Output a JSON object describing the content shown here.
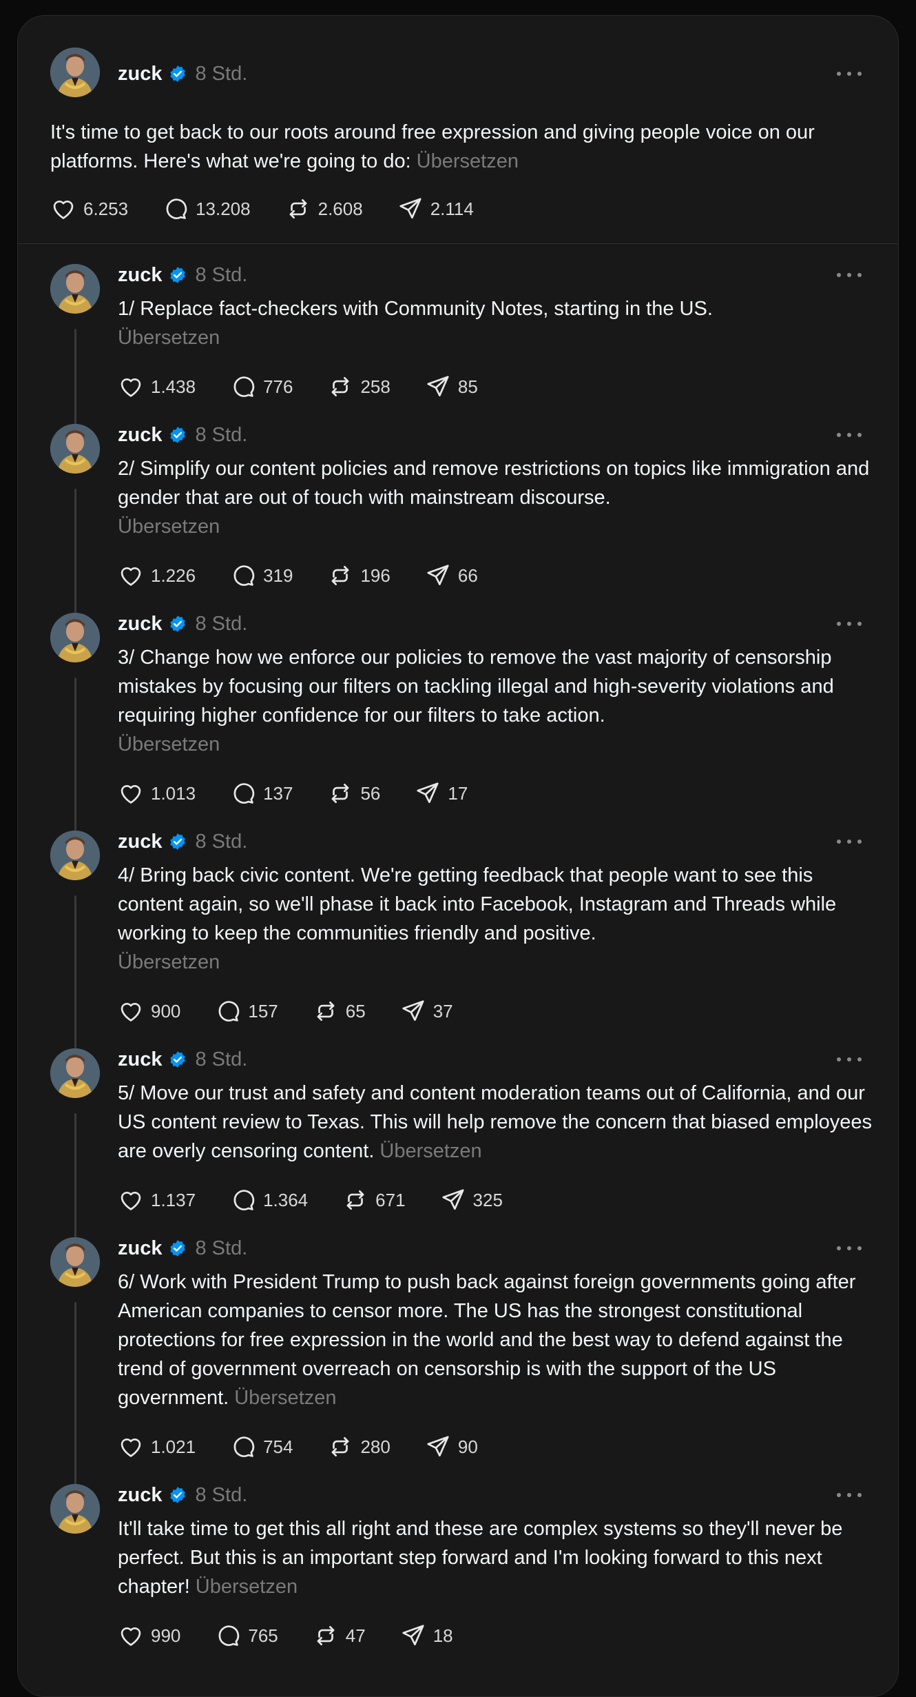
{
  "posts": [
    {
      "username": "zuck",
      "time": "8 Std.",
      "text": "It's time to get back to our roots around free expression and giving people voice on our platforms. Here's what we're going to do:",
      "translate": "Übersetzen",
      "likes": "6.253",
      "replies": "13.208",
      "reposts": "2.608",
      "shares": "2.114"
    },
    {
      "username": "zuck",
      "time": "8 Std.",
      "text": "1/ Replace fact-checkers with Community Notes, starting in the US.",
      "translate": "Übersetzen",
      "likes": "1.438",
      "replies": "776",
      "reposts": "258",
      "shares": "85"
    },
    {
      "username": "zuck",
      "time": "8 Std.",
      "text": "2/ Simplify our content policies and remove restrictions on topics like immigration and gender that are out of touch with mainstream discourse.",
      "translate": "Übersetzen",
      "likes": "1.226",
      "replies": "319",
      "reposts": "196",
      "shares": "66"
    },
    {
      "username": "zuck",
      "time": "8 Std.",
      "text": "3/ Change how we enforce our policies to remove the vast majority of censorship mistakes by focusing our filters on tackling illegal and high-severity violations and requiring higher confidence for our filters to take action.",
      "translate": "Übersetzen",
      "likes": "1.013",
      "replies": "137",
      "reposts": "56",
      "shares": "17"
    },
    {
      "username": "zuck",
      "time": "8 Std.",
      "text": "4/ Bring back civic content. We're getting feedback that people want to see this content again, so we'll phase it back into Facebook, Instagram and Threads while working to keep the communities friendly and positive.",
      "translate": "Übersetzen",
      "likes": "900",
      "replies": "157",
      "reposts": "65",
      "shares": "37"
    },
    {
      "username": "zuck",
      "time": "8 Std.",
      "text": "5/ Move our trust and safety and content moderation teams out of California, and our US content review to Texas. This will help remove the concern that biased employees are overly censoring content.",
      "translate": "Übersetzen",
      "likes": "1.137",
      "replies": "1.364",
      "reposts": "671",
      "shares": "325"
    },
    {
      "username": "zuck",
      "time": "8 Std.",
      "text": "6/ Work with President Trump to push back against foreign governments going after American companies to censor more. The US has the strongest constitutional protections for free expression in the world and the best way to defend against the trend of government overreach on censorship is with the support of the US government.",
      "translate": "Übersetzen",
      "likes": "1.021",
      "replies": "754",
      "reposts": "280",
      "shares": "90"
    },
    {
      "username": "zuck",
      "time": "8 Std.",
      "text": "It'll take time to get this all right and these are complex systems so they'll never be perfect. But this is an important step forward and I'm looking forward to this next chapter!",
      "translate": "Übersetzen",
      "likes": "990",
      "replies": "765",
      "reposts": "47",
      "shares": "18"
    }
  ],
  "colors": {
    "background": "#181818",
    "text": "#f3f5f7",
    "muted": "#7a7a7a",
    "verified": "#0095f6"
  },
  "icons": {
    "like": "heart-icon",
    "reply": "comment-icon",
    "repost": "repost-icon",
    "share": "share-icon",
    "verified": "verified-badge-icon",
    "more": "more-icon"
  }
}
